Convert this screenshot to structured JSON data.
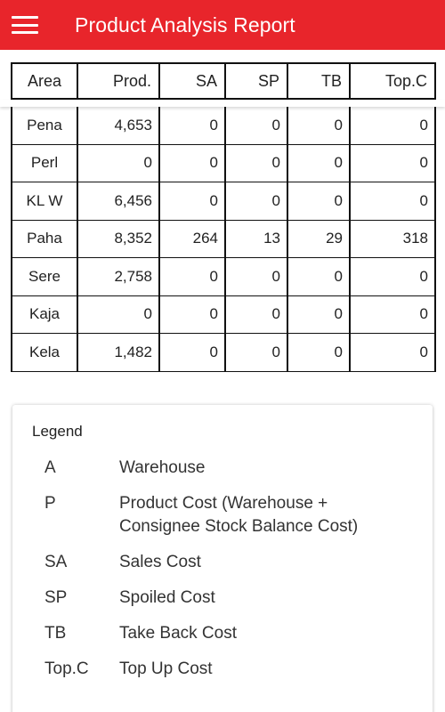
{
  "app_bar": {
    "title": "Product Analysis Report",
    "menu_icon": "hamburger-menu-icon",
    "color": "#e8252b"
  },
  "table": {
    "headers": [
      "Area",
      "Prod.",
      "SA",
      "SP",
      "TB",
      "Top.C"
    ],
    "rows": [
      [
        "Pena",
        "4,653",
        "0",
        "0",
        "0",
        "0"
      ],
      [
        "Perl",
        "0",
        "0",
        "0",
        "0",
        "0"
      ],
      [
        "KL W",
        "6,456",
        "0",
        "0",
        "0",
        "0"
      ],
      [
        "Paha",
        "8,352",
        "264",
        "13",
        "29",
        "318"
      ],
      [
        "Sere",
        "2,758",
        "0",
        "0",
        "0",
        "0"
      ],
      [
        "Kaja",
        "0",
        "0",
        "0",
        "0",
        "0"
      ],
      [
        "Kela",
        "1,482",
        "0",
        "0",
        "0",
        "0"
      ]
    ]
  },
  "legend": {
    "title": "Legend",
    "items": [
      {
        "key": "A",
        "value": "Warehouse"
      },
      {
        "key": "P",
        "value": "Product Cost (Warehouse + Consignee Stock Balance Cost)"
      },
      {
        "key": "SA",
        "value": "Sales Cost"
      },
      {
        "key": "SP",
        "value": "Spoiled Cost"
      },
      {
        "key": "TB",
        "value": "Take Back Cost"
      },
      {
        "key": "Top.C",
        "value": "Top Up Cost"
      }
    ]
  }
}
